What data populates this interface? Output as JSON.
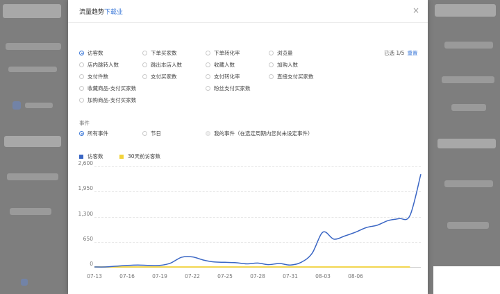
{
  "modal": {
    "title_prefix": "流量趋势",
    "title_link": "下载业",
    "close_icon": "×"
  },
  "metrics": {
    "options": [
      {
        "label": "访客数",
        "checked": true
      },
      {
        "label": "下单买家数",
        "checked": false
      },
      {
        "label": "下单转化率",
        "checked": false
      },
      {
        "label": "浏览量",
        "checked": false
      },
      {
        "label": "店内跳转人数",
        "checked": false
      },
      {
        "label": "跳出本店人数",
        "checked": false
      },
      {
        "label": "收藏人数",
        "checked": false
      },
      {
        "label": "加购人数",
        "checked": false
      },
      {
        "label": "支付件数",
        "checked": false
      },
      {
        "label": "支付买家数",
        "checked": false
      },
      {
        "label": "支付转化率",
        "checked": false
      },
      {
        "label": "直接支付买家数",
        "checked": false
      },
      {
        "label": "收藏商品-支付买家数",
        "checked": false
      },
      {
        "label": "粉丝支付买家数",
        "checked": false
      },
      {
        "label": "加购商品-支付买家数",
        "checked": false
      }
    ],
    "selected_text": "已选 1/5",
    "reset_label": "重置"
  },
  "events": {
    "label": "事件",
    "options": [
      {
        "label": "所有事件",
        "checked": true,
        "disabled": false
      },
      {
        "label": "节日",
        "checked": false,
        "disabled": false
      },
      {
        "label": "我的事件（在选定周期内您尚未设定事件）",
        "checked": false,
        "disabled": true
      }
    ]
  },
  "colors": {
    "series_visitors": "#3a66c4",
    "series_30days": "#f2d33a"
  },
  "chart_data": {
    "type": "line",
    "x": [
      "07-13",
      "07-14",
      "07-15",
      "07-16",
      "07-17",
      "07-18",
      "07-19",
      "07-20",
      "07-21",
      "07-22",
      "07-23",
      "07-24",
      "07-25",
      "07-26",
      "07-27",
      "07-28",
      "07-29",
      "07-30",
      "07-31",
      "08-01",
      "08-02",
      "08-03",
      "08-04",
      "08-05",
      "08-06",
      "08-07",
      "08-08",
      "08-09",
      "08-10",
      "08-11",
      "08-12"
    ],
    "xticks": [
      "07-13",
      "07-16",
      "07-19",
      "07-22",
      "07-25",
      "07-28",
      "07-31",
      "08-03",
      "08-06"
    ],
    "yticks": [
      "2,600",
      "1,950",
      "1,300",
      "650",
      "0"
    ],
    "ylim": [
      0,
      2600
    ],
    "series": [
      {
        "name": "访客数",
        "values": [
          0,
          0,
          20,
          40,
          50,
          40,
          40,
          100,
          250,
          260,
          180,
          130,
          120,
          110,
          80,
          100,
          60,
          90,
          50,
          120,
          350,
          900,
          720,
          800,
          900,
          1020,
          1080,
          1200,
          1250,
          1330,
          2400
        ]
      },
      {
        "name": "30天前访客数",
        "values": [
          0,
          0,
          0,
          0,
          0,
          0,
          0,
          0,
          0,
          0,
          0,
          0,
          0,
          0,
          0,
          0,
          0,
          0,
          0,
          0,
          0,
          0,
          0,
          0,
          0,
          0,
          0,
          0,
          0,
          0,
          null
        ]
      }
    ],
    "legend_position": "top-left",
    "grid": true
  }
}
